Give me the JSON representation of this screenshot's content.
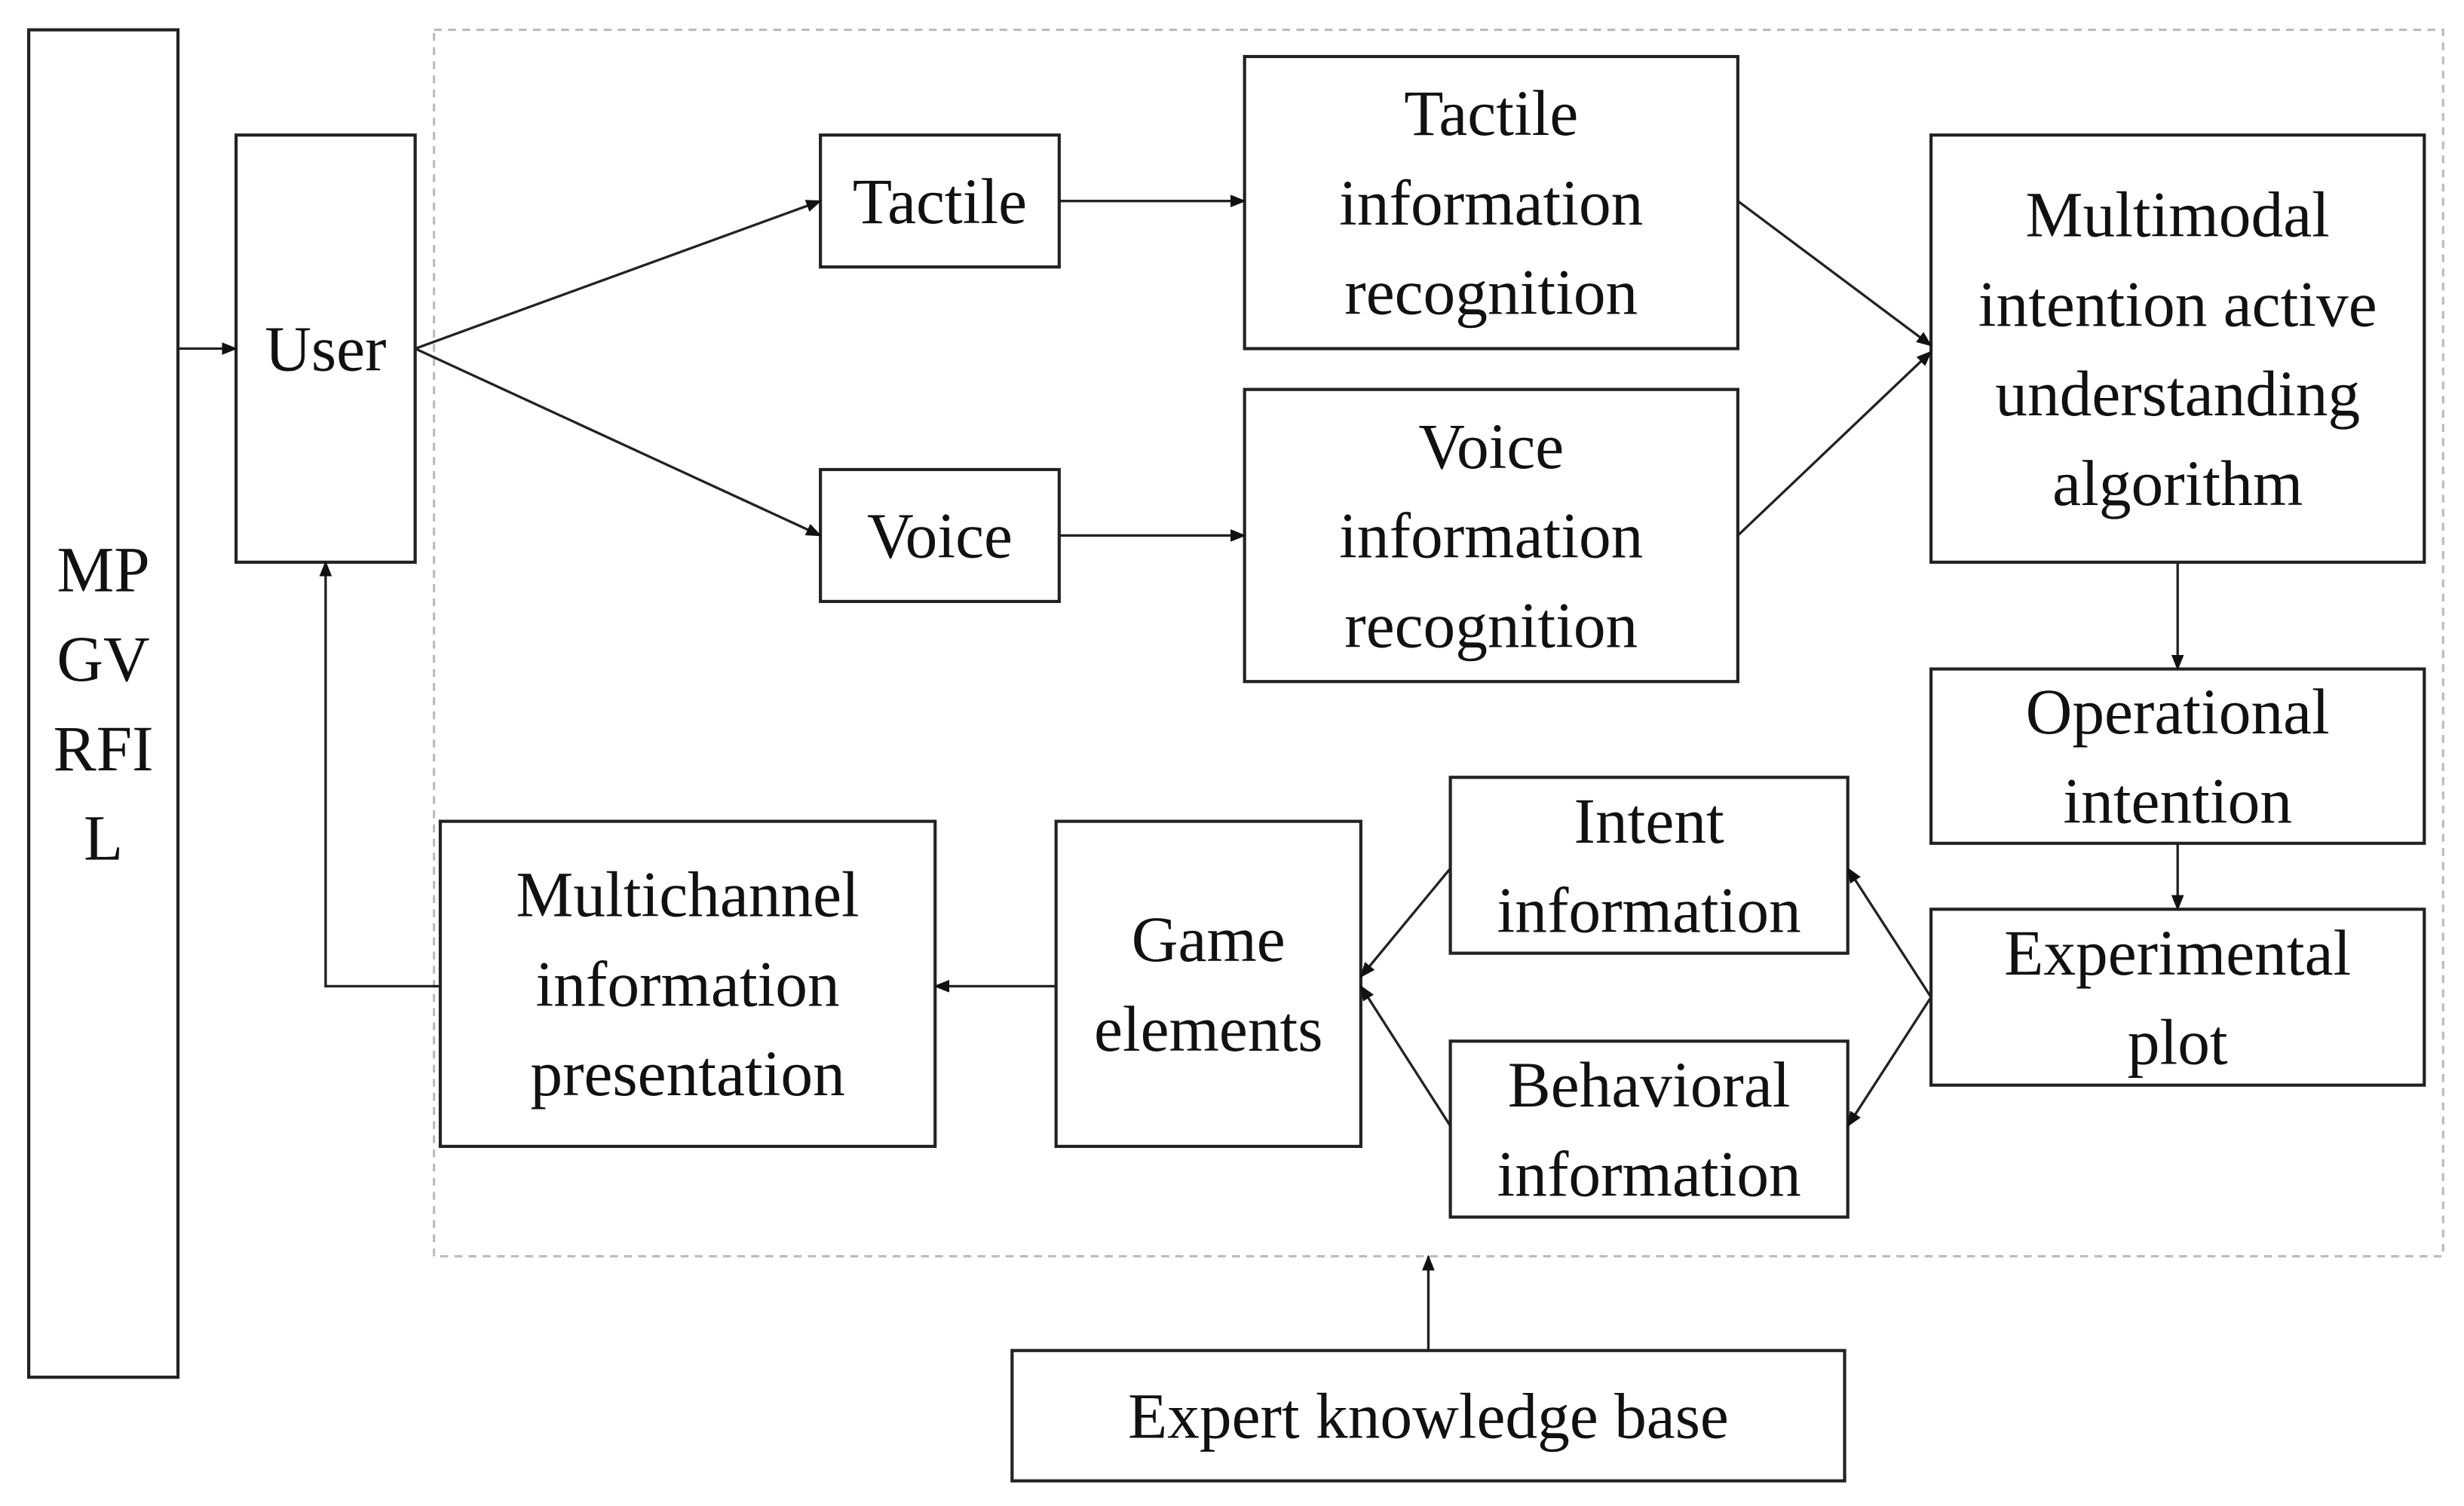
{
  "diagram": {
    "side_label": [
      "MP",
      "GV",
      "RFI",
      "L"
    ],
    "nodes": {
      "user": [
        "User"
      ],
      "tactile": [
        "Tactile"
      ],
      "voice": [
        "Voice"
      ],
      "tactile_recognition": [
        "Tactile",
        "information",
        "recognition"
      ],
      "voice_recognition": [
        "Voice",
        "information",
        "recognition"
      ],
      "multimodal": [
        "Multimodal",
        "intention active",
        "understanding",
        "algorithm"
      ],
      "operational": [
        "Operational",
        "intention"
      ],
      "experimental": [
        "Experimental",
        "plot"
      ],
      "intent": [
        "Intent",
        "information"
      ],
      "behavioral": [
        "Behavioral",
        "information"
      ],
      "game": [
        "Game",
        "elements"
      ],
      "multichannel": [
        "Multichannel",
        "information",
        "presentation"
      ],
      "expert": [
        "Expert knowledge base"
      ]
    },
    "edges": [
      [
        "side",
        "user"
      ],
      [
        "user",
        "tactile"
      ],
      [
        "user",
        "voice"
      ],
      [
        "tactile",
        "tactile_recognition"
      ],
      [
        "voice",
        "voice_recognition"
      ],
      [
        "tactile_recognition",
        "multimodal"
      ],
      [
        "voice_recognition",
        "multimodal"
      ],
      [
        "multimodal",
        "operational"
      ],
      [
        "operational",
        "experimental"
      ],
      [
        "experimental",
        "intent"
      ],
      [
        "experimental",
        "behavioral"
      ],
      [
        "intent",
        "game"
      ],
      [
        "behavioral",
        "game"
      ],
      [
        "game",
        "multichannel"
      ],
      [
        "multichannel",
        "user"
      ],
      [
        "expert",
        "dashed-region"
      ]
    ]
  }
}
